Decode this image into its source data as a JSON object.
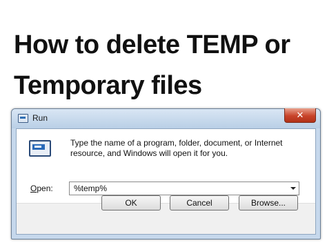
{
  "headline": {
    "line1": "How to delete TEMP or",
    "line2": "Temporary files"
  },
  "dialog": {
    "title": "Run",
    "close_glyph": "✕",
    "description": "Type the name of a program, folder, document, or Internet resource, and Windows will open it for you.",
    "open_label_underlined": "O",
    "open_label_rest": "pen:",
    "open_value": "%temp%",
    "buttons": {
      "ok": "OK",
      "cancel": "Cancel",
      "browse": "Browse..."
    },
    "icons": {
      "title": "run-icon",
      "main": "run-icon",
      "close": "close-icon",
      "dropdown": "chevron-down-icon"
    }
  }
}
